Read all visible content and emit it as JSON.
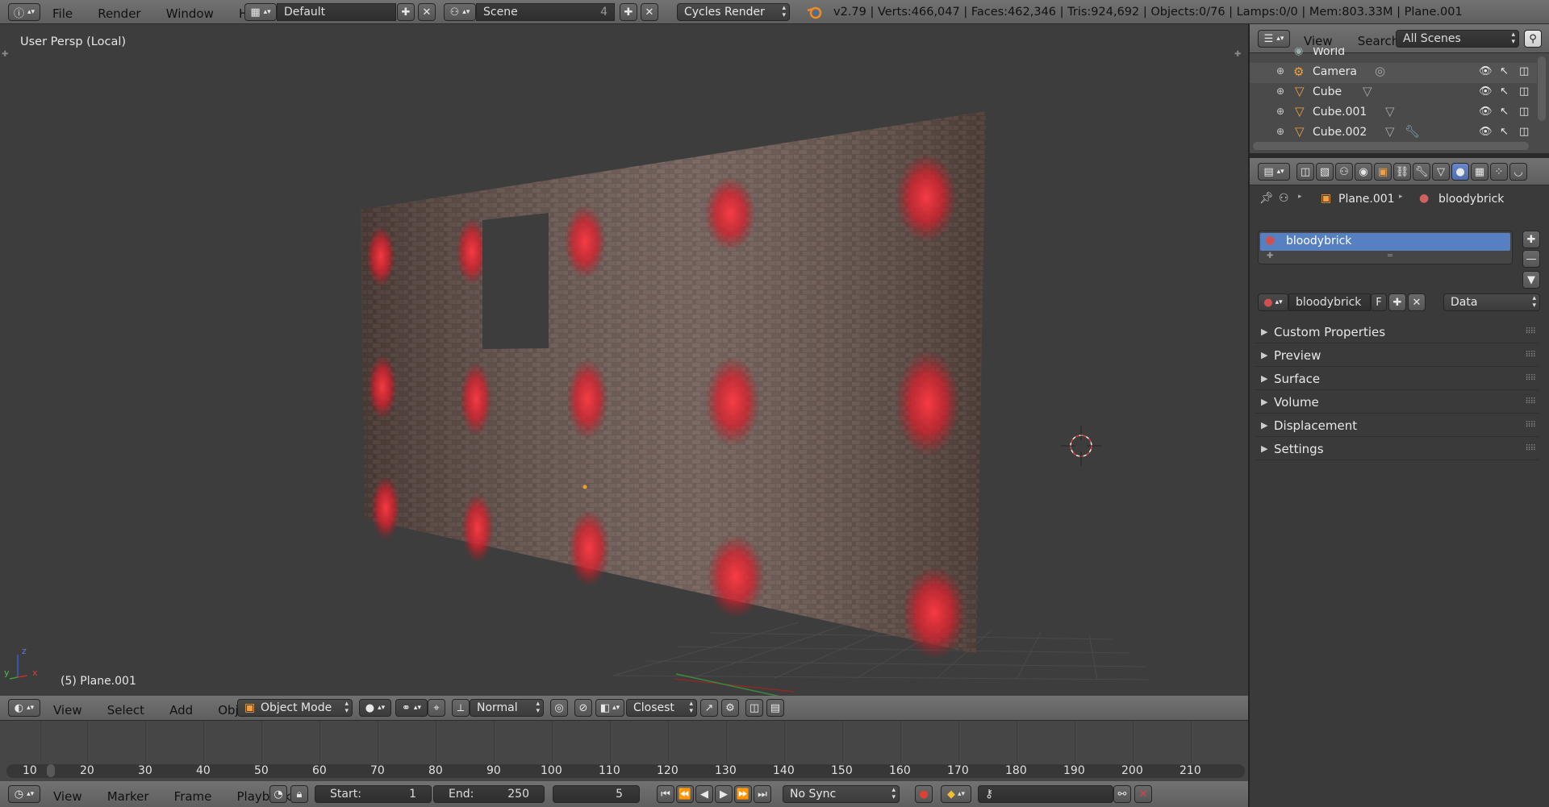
{
  "top_bar": {
    "menu": [
      "File",
      "Render",
      "Window",
      "Help"
    ],
    "layout_name": "Default",
    "scene_name": "Scene",
    "scene_users": "4",
    "render_engine": "Cycles Render",
    "stats": "v2.79 | Verts:466,047 | Faces:462,346 | Tris:924,692 | Objects:0/76 | Lamps:0/0 | Mem:803.33M | Plane.001"
  },
  "viewport": {
    "view_label": "User Persp (Local)",
    "object_label": "(5) Plane.001",
    "axis_labels": {
      "z": "z",
      "y": "y",
      "x": "x"
    }
  },
  "view3d_header": {
    "menu": [
      "View",
      "Select",
      "Add",
      "Object"
    ],
    "mode": "Object Mode",
    "orientation": "Normal",
    "snap_target": "Closest"
  },
  "outliner": {
    "menu": [
      "View",
      "Search"
    ],
    "display_mode": "All Scenes",
    "rows": [
      {
        "name": "World"
      },
      {
        "name": "Camera"
      },
      {
        "name": "Cube"
      },
      {
        "name": "Cube.001"
      },
      {
        "name": "Cube.002"
      }
    ]
  },
  "properties": {
    "breadcrumb": {
      "object": "Plane.001",
      "material": "bloodybrick"
    },
    "material_slot": "bloodybrick",
    "material_name": "bloodybrick",
    "fake_user": "F",
    "link": "Data",
    "panels": [
      "Custom Properties",
      "Preview",
      "Surface",
      "Volume",
      "Displacement",
      "Settings"
    ]
  },
  "timeline": {
    "ticks": [
      "10",
      "20",
      "30",
      "40",
      "50",
      "60",
      "70",
      "80",
      "90",
      "100",
      "110",
      "120",
      "130",
      "140",
      "150",
      "160",
      "170",
      "180",
      "190",
      "200",
      "210"
    ]
  },
  "timeline_header": {
    "menu": [
      "View",
      "Marker",
      "Frame",
      "Playback"
    ],
    "start_label": "Start:",
    "start_value": "1",
    "end_label": "End:",
    "end_value": "250",
    "current_frame": "5",
    "sync": "No Sync"
  },
  "colors": {
    "accent_blue": "#5680c2",
    "brick": "#5c4a44",
    "blood": "#e8303a"
  }
}
